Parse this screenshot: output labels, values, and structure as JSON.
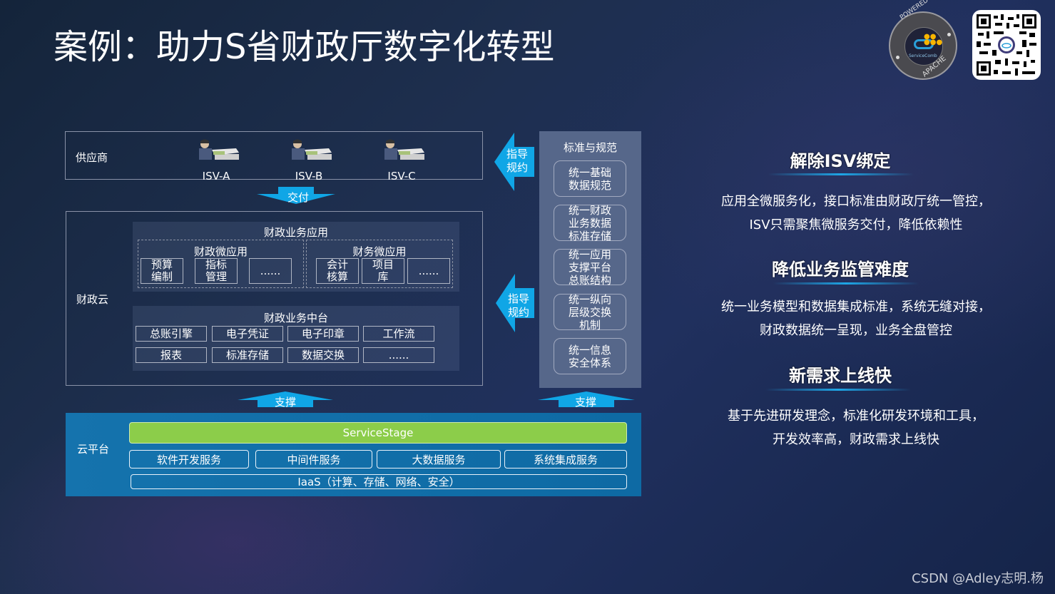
{
  "title": "案例：助力S省财政厅数字化转型",
  "badge": {
    "top_text": "POWERED BY",
    "logo_text": "ServiceComb",
    "bottom_text": "APACHE"
  },
  "qr_code": {
    "icon": "qr-code"
  },
  "supplier": {
    "label": "供应商",
    "isvs": [
      {
        "name": "ISV-A",
        "icon": "developer-at-desk"
      },
      {
        "name": "ISV-B",
        "icon": "developer-at-desk"
      },
      {
        "name": "ISV-C",
        "icon": "developer-at-desk"
      }
    ]
  },
  "arrows": {
    "deliver": "交付",
    "guide1": [
      "指导",
      "规约"
    ],
    "guide2": [
      "指导",
      "规约"
    ],
    "support_left": "支撑",
    "support_right": "支撑"
  },
  "finance_cloud": {
    "label": "财政云",
    "apps": {
      "title": "财政业务应用",
      "groups": [
        {
          "title": "财政微应用",
          "items": [
            [
              "预算",
              "编制"
            ],
            [
              "指标",
              "管理"
            ],
            [
              "......"
            ]
          ]
        },
        {
          "title": "财务微应用",
          "items": [
            [
              "会计",
              "核算"
            ],
            [
              "项目",
              "库"
            ],
            [
              "......"
            ]
          ]
        }
      ]
    },
    "middle": {
      "title": "财政业务中台",
      "rows": [
        [
          "总账引擎",
          "电子凭证",
          "电子印章",
          "工作流"
        ],
        [
          "报表",
          "标准存储",
          "数据交换",
          "......"
        ]
      ]
    }
  },
  "standards": {
    "title": "标准与规范",
    "items": [
      [
        "统一基础",
        "数据规范"
      ],
      [
        "统一财政",
        "业务数据",
        "标准存储"
      ],
      [
        "统一应用",
        "支撑平台",
        "总账结构"
      ],
      [
        "统一纵向",
        "层级交换",
        "机制"
      ],
      [
        "统一信息",
        "安全体系"
      ]
    ]
  },
  "cloud_platform": {
    "label": "云平台",
    "servicestage": "ServiceStage",
    "services": [
      "软件开发服务",
      "中间件服务",
      "大数据服务",
      "系统集成服务"
    ],
    "iaas": "IaaS（计算、存储、网络、安全）"
  },
  "benefits": [
    {
      "heading": "解除ISV绑定",
      "lines": [
        "应用全微服务化，接口标准由财政厅统一管控，",
        "ISV只需聚焦微服务交付，降低依赖性"
      ]
    },
    {
      "heading": "降低业务监管难度",
      "lines": [
        "统一业务模型和数据集成标准，系统无缝对接，",
        "财政数据统一呈现，业务全盘管控"
      ]
    },
    {
      "heading": "新需求上线快",
      "lines": [
        "基于先进研发理念，标准化研发环境和工具，",
        "开发效率高，财政需求上线快"
      ]
    }
  ],
  "watermark": "CSDN @Adley志明.杨",
  "colors": {
    "accent_blue": "#10a6e6",
    "servicestage_green": "#8ccd4a",
    "cloud_panel": "#1573ad",
    "standards_panel": "#56678a"
  }
}
